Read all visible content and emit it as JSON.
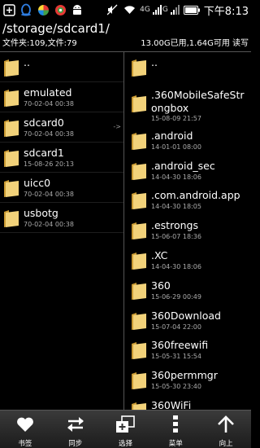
{
  "status_bar": {
    "network_label": "4G",
    "signal_label": "G",
    "time": "下午8:13"
  },
  "path": "/storage/sdcard1/",
  "info": {
    "counts": "文件夹:109,文件:79",
    "storage": "13.00G已用,1.64G可用 读写"
  },
  "left_pane": {
    "items": [
      {
        "name": "..",
        "date": ""
      },
      {
        "name": "emulated",
        "date": "70-02-04 00:38"
      },
      {
        "name": "sdcard0",
        "date": "70-02-04 00:38",
        "arrow": "->"
      },
      {
        "name": "sdcard1",
        "date": "15-08-26 20:13"
      },
      {
        "name": "uicc0",
        "date": "70-02-04 00:38"
      },
      {
        "name": "usbotg",
        "date": "70-02-04 00:38"
      }
    ]
  },
  "right_pane": {
    "items": [
      {
        "name": "..",
        "date": ""
      },
      {
        "name": ".360MobileSafeStrongbox",
        "date": "15-08-09 21:57"
      },
      {
        "name": ".android",
        "date": "14-01-01 08:00"
      },
      {
        "name": ".android_sec",
        "date": "14-04-30 18:06"
      },
      {
        "name": ".com.android.app",
        "date": "14-04-30 18:05"
      },
      {
        "name": ".estrongs",
        "date": "15-06-07 18:36"
      },
      {
        "name": ".XC",
        "date": "14-04-30 18:06"
      },
      {
        "name": "360",
        "date": "15-06-29 00:49"
      },
      {
        "name": "360Download",
        "date": "15-07-04 22:00"
      },
      {
        "name": "360freewifi",
        "date": "15-05-31 15:54"
      },
      {
        "name": "360permmgr",
        "date": "15-05-30 23:40"
      },
      {
        "name": "360WiFi",
        "date": ""
      }
    ]
  },
  "toolbar": {
    "bookmark": "书签",
    "sync": "同步",
    "select": "选择",
    "menu": "菜单",
    "up": "向上"
  },
  "colors": {
    "folder": "#f2d27a",
    "folder_dark": "#d8ab3c",
    "background": "#000000",
    "toolbar": "#2a2a2a"
  }
}
